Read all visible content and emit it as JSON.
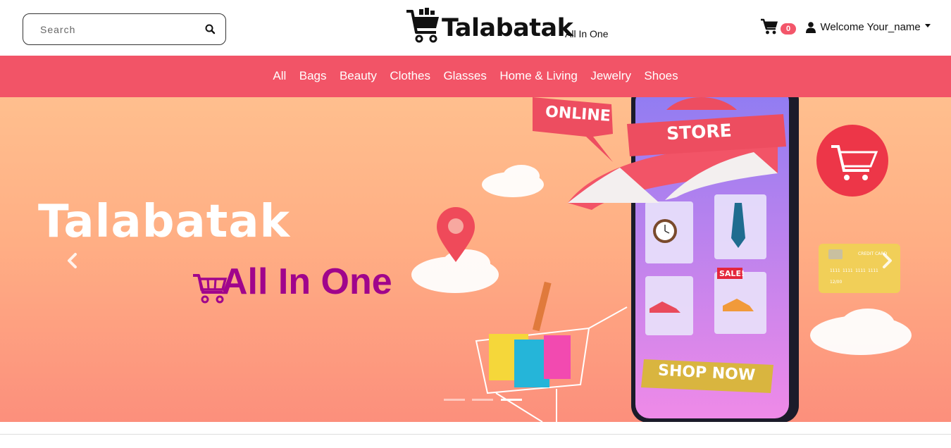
{
  "header": {
    "search": {
      "placeholder": "Search",
      "value": ""
    },
    "logo": {
      "title": "Talabatak",
      "subtitle": "All In One"
    },
    "cart": {
      "count": "0"
    },
    "user": {
      "greeting": "Welcome Your_name"
    }
  },
  "nav": {
    "items": [
      {
        "label": "All"
      },
      {
        "label": "Bags"
      },
      {
        "label": "Beauty"
      },
      {
        "label": "Clothes"
      },
      {
        "label": "Glasses"
      },
      {
        "label": "Home & Living"
      },
      {
        "label": "Jewelry"
      },
      {
        "label": "Shoes"
      }
    ]
  },
  "carousel": {
    "title": "Talabatak",
    "subtitle": "All In One",
    "sign_online": "ONLINE",
    "sign_store": "STORE",
    "sign_sale": "SALE!",
    "sign_shop_now": "SHOP NOW",
    "card_label": "CREDIT CARD",
    "card_number": "1111 1111 1111 1111",
    "card_expiry": "12/00",
    "slide_count": 3,
    "active_slide": 3
  },
  "colors": {
    "nav_bg": "#f25467",
    "badge": "#f3566a",
    "banner_subtitle": "#a0048c"
  }
}
